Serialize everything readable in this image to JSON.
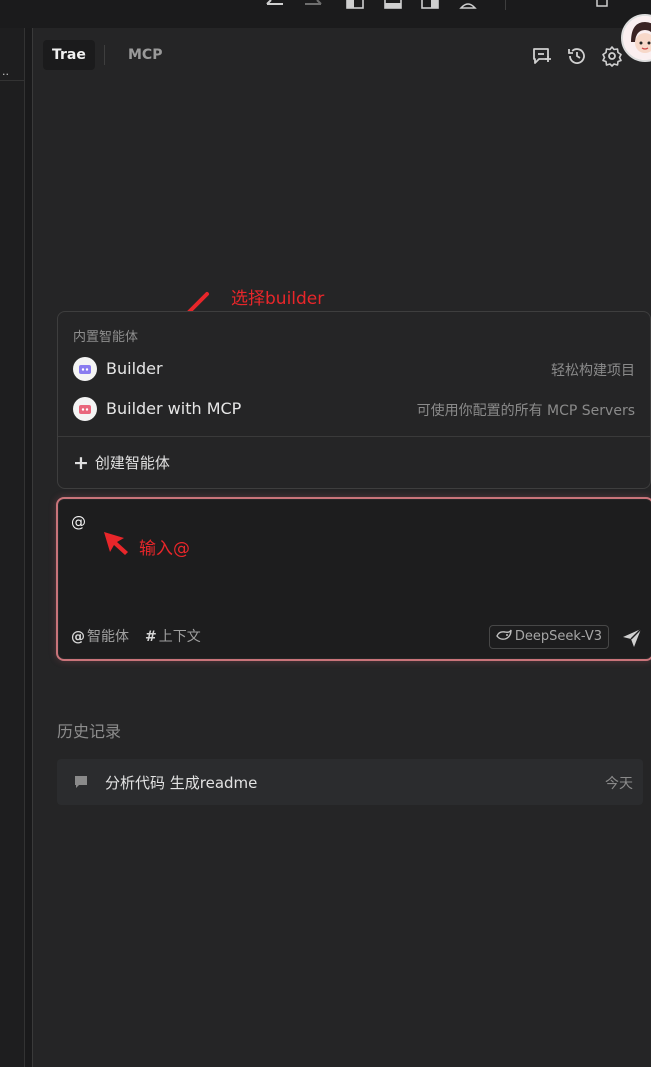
{
  "header": {
    "tabs": [
      {
        "label": "Trae",
        "active": true
      },
      {
        "label": "MCP",
        "active": false
      }
    ],
    "icons": [
      "new-chat-icon",
      "history-icon",
      "settings-icon"
    ]
  },
  "left_pane": {
    "menu_glyph": "··"
  },
  "annotations": {
    "select_builder": "选择builder",
    "type_at": "输入@"
  },
  "dropdown": {
    "header": "内置智能体",
    "items": [
      {
        "name": "Builder",
        "desc": "轻松构建项目",
        "icon": "builder-agent-icon"
      },
      {
        "name": "Builder with MCP",
        "desc": "可使用你配置的所有 MCP Servers",
        "icon": "builder-mcp-agent-icon"
      }
    ],
    "create_label": "创建智能体"
  },
  "input": {
    "value": "@",
    "chip_agent_symbol": "@",
    "chip_agent_label": "智能体",
    "chip_context_symbol": "#",
    "chip_context_label": "上下文",
    "model": "DeepSeek-V3"
  },
  "history": {
    "title": "历史记录",
    "items": [
      {
        "title": "分析代码 生成readme",
        "date": "今天"
      }
    ]
  },
  "colors": {
    "annotation": "#e8262a",
    "input_border_start": "#e56b7a",
    "input_border_end": "#a6a3e6"
  }
}
